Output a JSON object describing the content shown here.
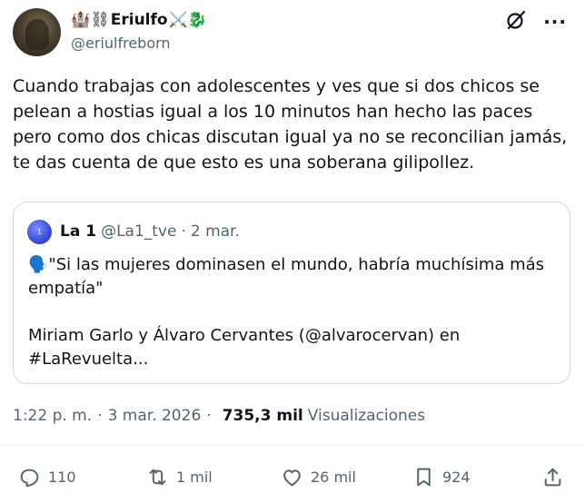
{
  "author": {
    "name": "Eriulfo",
    "emoji_before": "🏰⛓",
    "emoji_after": "⚔️🐉",
    "handle": "@eriulfreborn"
  },
  "header_icons": {
    "grok_icon": "slashed-circle-icon",
    "more": "···"
  },
  "tweet": {
    "text": "Cuando trabajas con adolescentes y ves que si dos chicos se pelean a hostias igual a los 10 minutos han hecho las paces pero como dos chicas discutan igual ya no se reconcilian jamás, te das cuenta de que esto es una soberana gilipollez."
  },
  "quote": {
    "avatar_label": "1",
    "name": "La 1",
    "handle": "@La1_tve",
    "dot": "·",
    "date": "2 mar.",
    "line1": "🗣️\"Si las mujeres dominasen el mundo, habría muchísima más empatía\"",
    "line2": "Miriam Garlo y Álvaro Cervantes (@alvarocervan) en #LaRevuelta..."
  },
  "meta": {
    "time": "1:22 p. m.",
    "date": "3 mar. 2026",
    "views_count": "735,3 mil",
    "views_label": "Visualizaciones",
    "separator": "·"
  },
  "actions": {
    "replies": "110",
    "reposts": "1 mil",
    "likes": "26 mil",
    "bookmarks": "924"
  },
  "colors": {
    "text": "#0f1419",
    "secondary": "#536471",
    "border": "#cfd9de"
  }
}
